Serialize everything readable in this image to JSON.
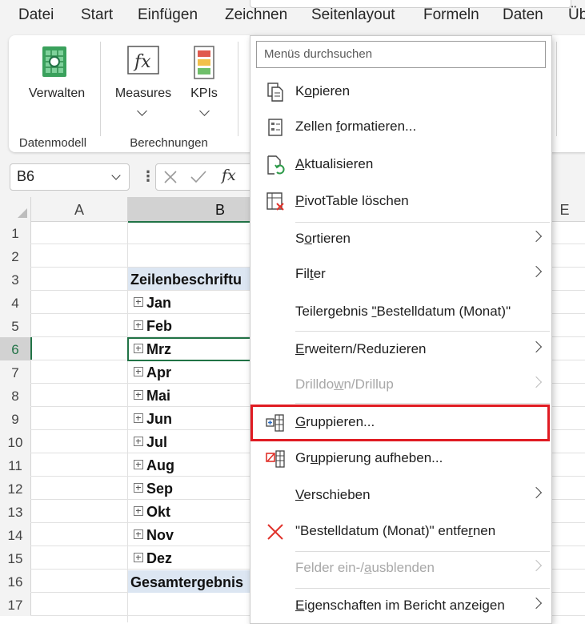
{
  "menu_tabs": [
    "Datei",
    "Start",
    "Einfügen",
    "Zeichnen",
    "Seitenlayout",
    "Formeln",
    "Daten",
    "Üb"
  ],
  "ribbon": {
    "verwalten": "Verwalten",
    "measures": "Measures",
    "kpis": "KPIs",
    "group_datenmodell": "Datenmodell",
    "group_berechnungen": "Berechnungen"
  },
  "formula_bar": {
    "name_box": "B6",
    "fx": "fx"
  },
  "columns": [
    "A",
    "B",
    "E"
  ],
  "rows": [
    "1",
    "2",
    "3",
    "4",
    "5",
    "6",
    "7",
    "8",
    "9",
    "10",
    "11",
    "12",
    "13",
    "14",
    "15",
    "16",
    "17"
  ],
  "pivot": {
    "header": "Zeilenbeschriftu",
    "months": [
      "Jan",
      "Feb",
      "Mrz",
      "Apr",
      "Mai",
      "Jun",
      "Jul",
      "Aug",
      "Sep",
      "Okt",
      "Nov",
      "Dez"
    ],
    "total": "Gesamtergebnis"
  },
  "context_menu": {
    "search_placeholder": "Menüs durchsuchen",
    "items": [
      {
        "pre": "K",
        "u": "o",
        "post": "pieren",
        "icon": "copy-icon"
      },
      {
        "pre": "Zellen ",
        "u": "f",
        "post": "ormatieren...",
        "icon": "format-cells-icon"
      },
      {
        "pre": "",
        "u": "A",
        "post": "ktualisieren",
        "icon": "refresh-icon"
      },
      {
        "pre": "",
        "u": "P",
        "post": "ivotTable löschen",
        "icon": "delete-pivot-icon"
      },
      {
        "pre": "S",
        "u": "o",
        "post": "rtieren",
        "icon": ""
      },
      {
        "pre": "Fil",
        "u": "t",
        "post": "er",
        "icon": ""
      },
      {
        "pre": "Teilergebnis ",
        "u": "\"",
        "post": "Bestelldatum (Monat)\"",
        "icon": ""
      },
      {
        "pre": "",
        "u": "E",
        "post": "rweitern/Reduzieren",
        "icon": ""
      },
      {
        "pre": "Drilldo",
        "u": "w",
        "post": "n/Drillup",
        "icon": ""
      },
      {
        "pre": "",
        "u": "G",
        "post": "ruppieren...",
        "icon": "group-icon"
      },
      {
        "pre": "Gr",
        "u": "u",
        "post": "ppierung aufheben...",
        "icon": "ungroup-icon"
      },
      {
        "pre": "",
        "u": "V",
        "post": "erschieben",
        "icon": ""
      },
      {
        "pre": "\"Bestelldatum (Monat)\" entfe",
        "u": "r",
        "post": "nen",
        "icon": "remove-icon"
      },
      {
        "pre": "Felder ein-/",
        "u": "a",
        "post": "usblenden",
        "icon": ""
      },
      {
        "pre": "",
        "u": "E",
        "post": "igenschaften im Bericht anzeigen",
        "icon": ""
      }
    ]
  }
}
